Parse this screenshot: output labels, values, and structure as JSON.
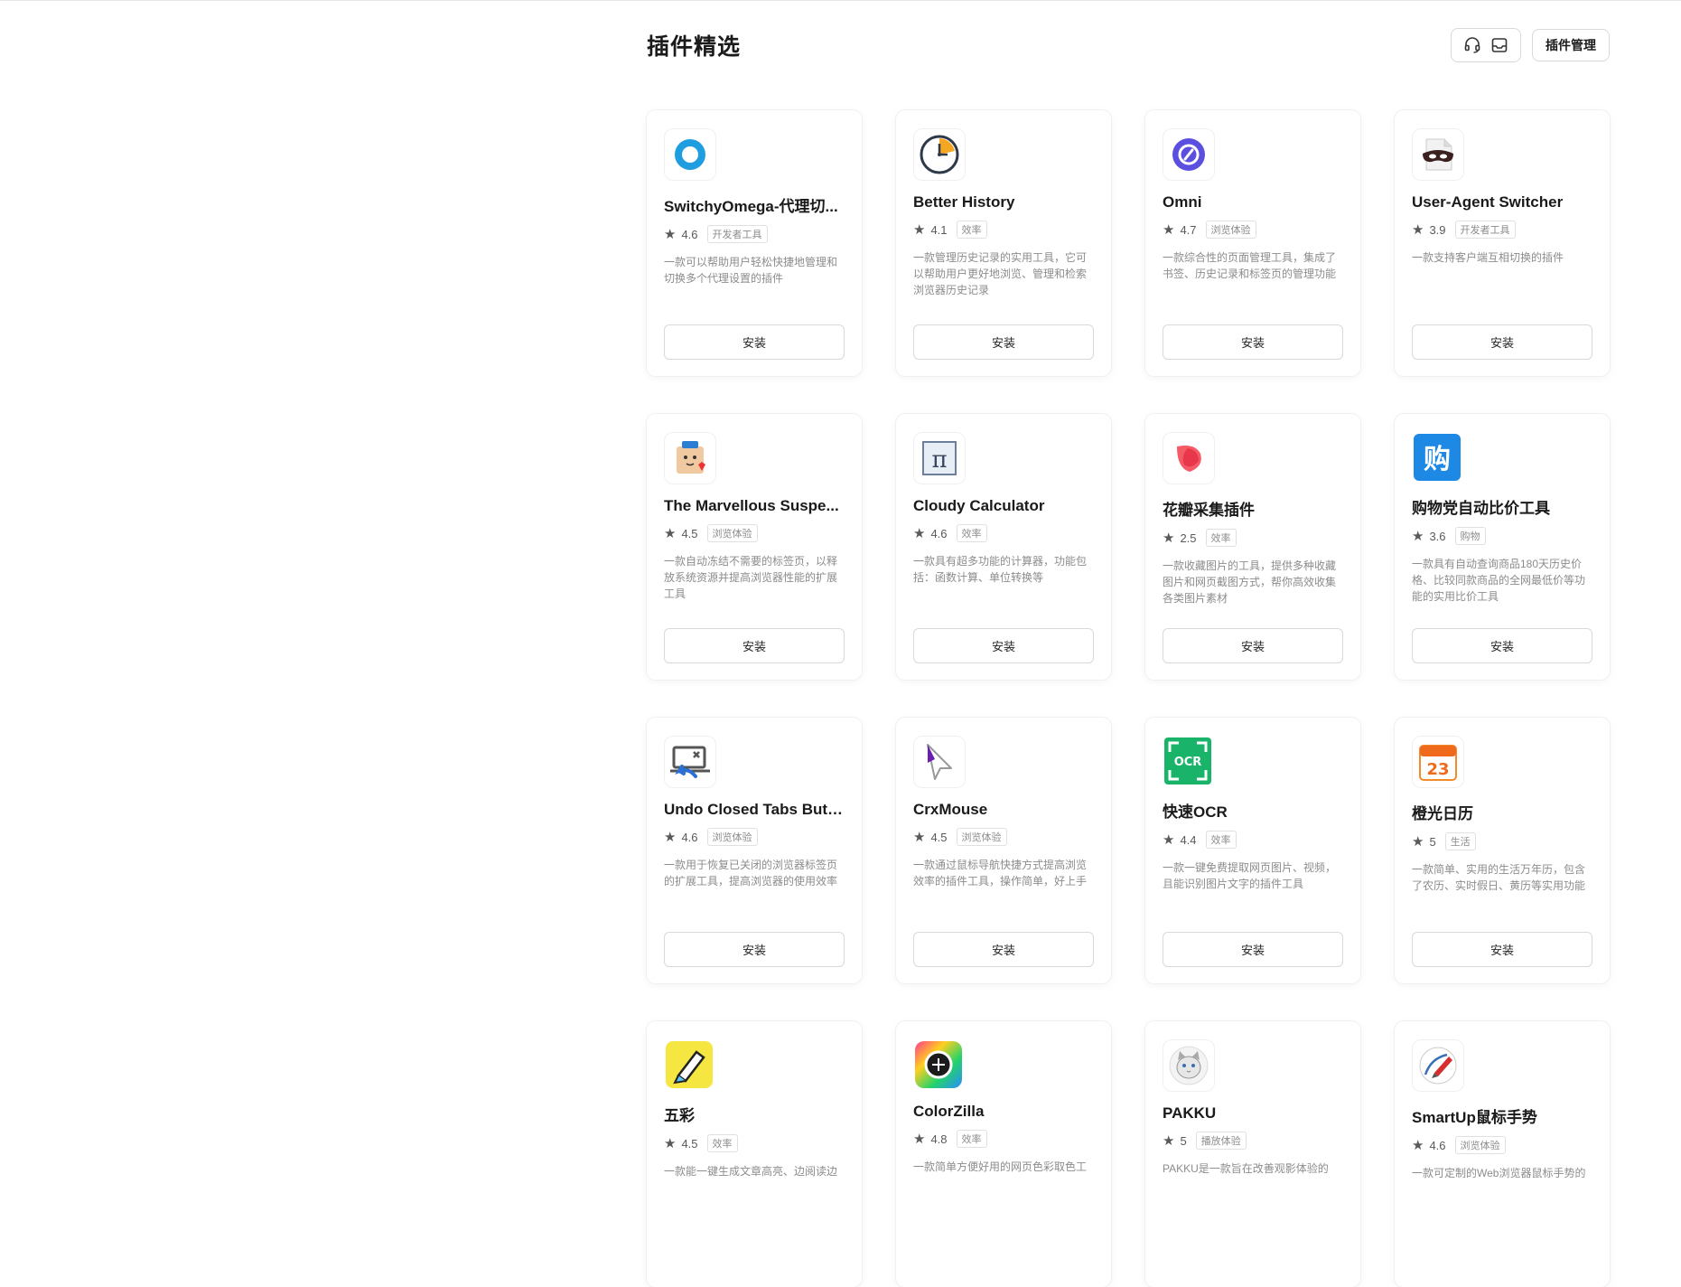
{
  "header": {
    "title": "插件精选",
    "manage_label": "插件管理"
  },
  "install_label": "安装",
  "plugins": [
    {
      "name": "SwitchyOmega-代理切...",
      "rating": "4.6",
      "tag": "开发者工具",
      "desc": "一款可以帮助用户轻松快捷地管理和切换多个代理设置的插件",
      "icon": "switchyomega-icon"
    },
    {
      "name": "Better History",
      "rating": "4.1",
      "tag": "效率",
      "desc": "一款管理历史记录的实用工具，它可以帮助用户更好地浏览、管理和检索浏览器历史记录",
      "icon": "better-history-icon"
    },
    {
      "name": "Omni",
      "rating": "4.7",
      "tag": "浏览体验",
      "desc": "一款综合性的页面管理工具，集成了书签、历史记录和标签页的管理功能",
      "icon": "omni-icon"
    },
    {
      "name": "User-Agent Switcher",
      "rating": "3.9",
      "tag": "开发者工具",
      "desc": "一款支持客户端互相切换的插件",
      "icon": "user-agent-switcher-icon"
    },
    {
      "name": "The Marvellous Suspe...",
      "rating": "4.5",
      "tag": "浏览体验",
      "desc": "一款自动冻结不需要的标签页，以释放系统资源并提高浏览器性能的扩展工具",
      "icon": "marvellous-suspender-icon"
    },
    {
      "name": "Cloudy Calculator",
      "rating": "4.6",
      "tag": "效率",
      "desc": "一款具有超多功能的计算器，功能包括：函数计算、单位转换等",
      "icon": "pi-calculator-icon"
    },
    {
      "name": "花瓣采集插件",
      "rating": "2.5",
      "tag": "效率",
      "desc": "一款收藏图片的工具，提供多种收藏图片和网页截图方式，帮你高效收集各类图片素材",
      "icon": "huaban-icon"
    },
    {
      "name": "购物党自动比价工具",
      "rating": "3.6",
      "tag": "购物",
      "desc": "一款具有自动查询商品180天历史价格、比较同款商品的全网最低价等功能的实用比价工具",
      "icon": "gouwudang-icon"
    },
    {
      "name": "Undo Closed Tabs Butt...",
      "rating": "4.6",
      "tag": "浏览体验",
      "desc": "一款用于恢复已关闭的浏览器标签页的扩展工具，提高浏览器的使用效率",
      "icon": "undo-closed-tabs-icon"
    },
    {
      "name": "CrxMouse",
      "rating": "4.5",
      "tag": "浏览体验",
      "desc": "一款通过鼠标导航快捷方式提高浏览效率的插件工具，操作简单，好上手",
      "icon": "crxmouse-icon"
    },
    {
      "name": "快速OCR",
      "rating": "4.4",
      "tag": "效率",
      "desc": "一款一键免费提取网页图片、视频，且能识别图片文字的插件工具",
      "icon": "ocr-icon"
    },
    {
      "name": "橙光日历",
      "rating": "5",
      "tag": "生活",
      "desc": "一款简单、实用的生活万年历，包含了农历、实时假日、黄历等实用功能",
      "icon": "calendar-icon"
    },
    {
      "name": "五彩",
      "rating": "4.5",
      "tag": "效率",
      "desc": "一款能一键生成文章高亮、边阅读边",
      "icon": "wucai-highlighter-icon"
    },
    {
      "name": "ColorZilla",
      "rating": "4.8",
      "tag": "效率",
      "desc": "一款简单方便好用的网页色彩取色工",
      "icon": "colorzilla-icon"
    },
    {
      "name": "PAKKU",
      "rating": "5",
      "tag": "播放体验",
      "desc": "PAKKU是一款旨在改善观影体验的",
      "icon": "pakku-cat-icon"
    },
    {
      "name": "SmartUp鼠标手势",
      "rating": "4.6",
      "tag": "浏览体验",
      "desc": "一款可定制的Web浏览器鼠标手势的",
      "icon": "smartup-gesture-icon"
    }
  ]
}
